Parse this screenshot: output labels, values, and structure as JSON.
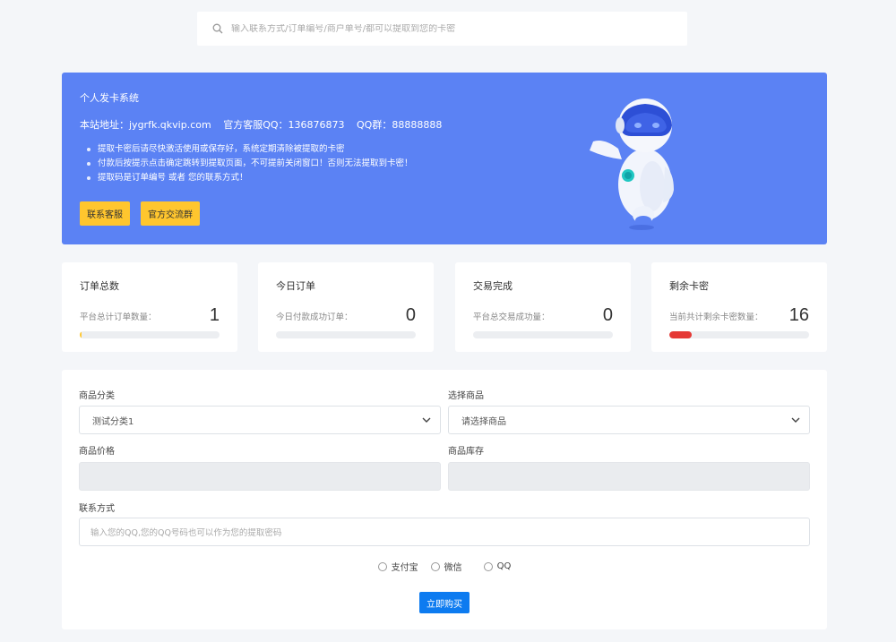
{
  "search": {
    "placeholder": "输入联系方式/订单编号/商户单号/都可以提取到您的卡密"
  },
  "hero": {
    "title": "个人发卡系统",
    "site": "本站地址：jygrfk.qkvip.com",
    "service_qq": "官方客服QQ：136876873",
    "group_qq": "QQ群：88888888",
    "notes": [
      "提取卡密后请尽快激活使用或保存好，系统定期清除被提取的卡密",
      "付款后按提示点击确定跳转到提取页面，不可提前关闭窗口！否则无法提取到卡密！",
      "提取码是订单编号 或者 您的联系方式！"
    ],
    "buttons": [
      "联系客服",
      "官方交流群"
    ]
  },
  "stats": [
    {
      "title": "订单总数",
      "sub": "平台总计订单数量：",
      "value": "1",
      "progress": 0.01,
      "color": "#ffc62e"
    },
    {
      "title": "今日订单",
      "sub": "今日付款成功订单：",
      "value": "0",
      "progress": 0,
      "color": "#5b82f4"
    },
    {
      "title": "交易完成",
      "sub": "平台总交易成功量：",
      "value": "0",
      "progress": 0,
      "color": "#5b82f4"
    },
    {
      "title": "剩余卡密",
      "sub": "当前共计剩余卡密数量：",
      "value": "16",
      "progress": 0.16,
      "color": "#e53935"
    }
  ],
  "form": {
    "category_label": "商品分类",
    "category_value": "测试分类1",
    "product_label": "选择商品",
    "product_value": "请选择商品",
    "price_label": "商品价格",
    "stock_label": "商品库存",
    "contact_label": "联系方式",
    "contact_placeholder": "输入您的QQ,您的QQ号码也可以作为您的提取密码",
    "payments": [
      "支付宝",
      "微信",
      "QQ"
    ],
    "buy_label": "立即购买"
  }
}
